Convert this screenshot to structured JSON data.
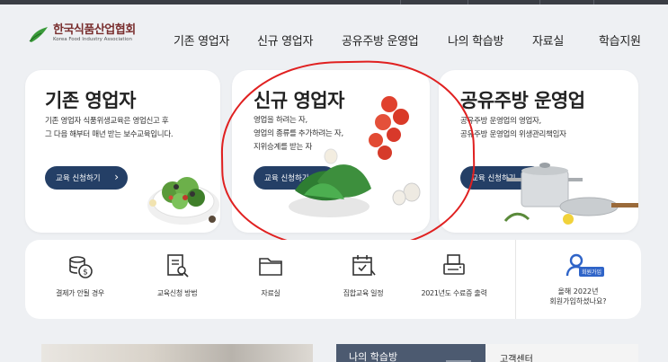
{
  "logo": {
    "name": "한국식품산업협회",
    "sub": "Korea Food Industry Association"
  },
  "nav": [
    {
      "label": "기존 영업자"
    },
    {
      "label": "신규 영업자"
    },
    {
      "label": "공유주방 운영업"
    },
    {
      "label": "나의 학습방"
    },
    {
      "label": "자료실"
    },
    {
      "label": "학습지원"
    }
  ],
  "cards": [
    {
      "title": "기존 영업자",
      "desc": [
        "기존 영업자 식품위생교육은 영업신고 후",
        "그 다음 해부터 매년 받는 보수교육입니다."
      ],
      "button": "교육 신청하기"
    },
    {
      "title": "신규 영업자",
      "desc": [
        "영업을 하려는 자,",
        "영업의 종류를 추가하려는 자,",
        "지위승계를 받는 자"
      ],
      "button": "교육 신청하기"
    },
    {
      "title": "공유주방 운영업",
      "desc": [
        "공유주방 운영업의 영업자,",
        "공유주방 운영업의 위생관리책임자"
      ],
      "button": "교육 신청하기"
    }
  ],
  "quick_links": [
    {
      "label": "결제가 안될 경우",
      "icon": "payment-coins-icon"
    },
    {
      "label": "교육신청 방법",
      "icon": "document-search-icon"
    },
    {
      "label": "자료실",
      "icon": "folder-icon"
    },
    {
      "label": "집합교육 일정",
      "icon": "calendar-icon"
    },
    {
      "label": "2021년도 수료증 출력",
      "icon": "printer-icon"
    }
  ],
  "member": {
    "badge": "회원가입",
    "line1": "올해 2022년",
    "line2": "회원가입하셨나요?",
    "icon": "user-icon"
  },
  "bottom": {
    "study_room": "나의 학습방",
    "support": "고객센터"
  },
  "colors": {
    "button": "#243f66",
    "annotation": "#e02020",
    "member_accent": "#2f64c8",
    "logo_green": "#3a9a3a"
  }
}
